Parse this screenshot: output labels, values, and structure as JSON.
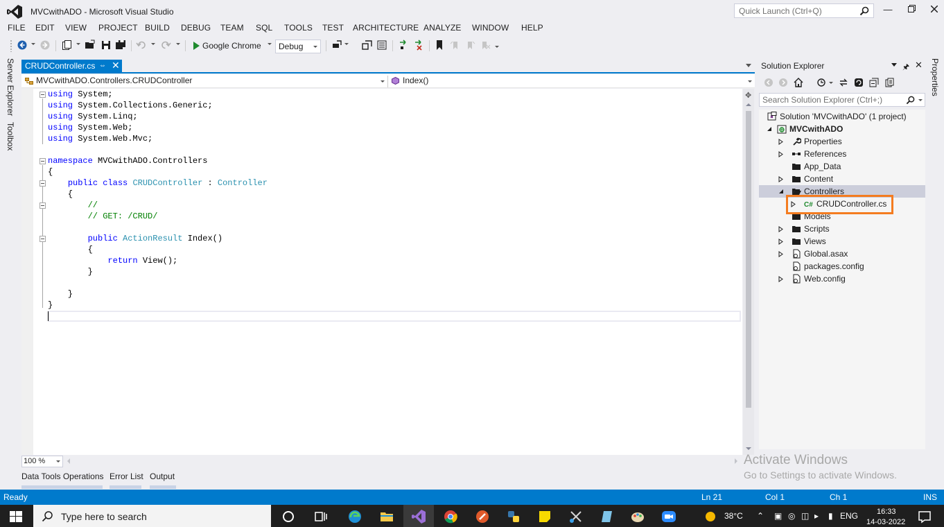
{
  "window": {
    "title": "MVCwithADO - Microsoft Visual Studio",
    "quick_launch_placeholder": "Quick Launch (Ctrl+Q)"
  },
  "menu": [
    "FILE",
    "EDIT",
    "VIEW",
    "PROJECT",
    "BUILD",
    "DEBUG",
    "TEAM",
    "SQL",
    "TOOLS",
    "TEST",
    "ARCHITECTURE",
    "ANALYZE",
    "WINDOW",
    "HELP"
  ],
  "toolbar": {
    "run_target": "Google Chrome",
    "configuration": "Debug"
  },
  "side_tabs": [
    "Server Explorer",
    "Toolbox"
  ],
  "document": {
    "tab_label": "CRUDController.cs",
    "nav_class": "MVCwithADO.Controllers.CRUDController",
    "nav_member": "Index()",
    "zoom": "100 %"
  },
  "code_lines": [
    [
      {
        "t": "using",
        "c": "kw"
      },
      {
        "t": " System;"
      }
    ],
    [
      {
        "t": "using",
        "c": "kw"
      },
      {
        "t": " System.Collections.Generic;"
      }
    ],
    [
      {
        "t": "using",
        "c": "kw"
      },
      {
        "t": " System.Linq;"
      }
    ],
    [
      {
        "t": "using",
        "c": "kw"
      },
      {
        "t": " System.Web;"
      }
    ],
    [
      {
        "t": "using",
        "c": "kw"
      },
      {
        "t": " System.Web.Mvc;"
      }
    ],
    [
      {
        "t": ""
      }
    ],
    [
      {
        "t": "namespace",
        "c": "kw"
      },
      {
        "t": " MVCwithADO.Controllers"
      }
    ],
    [
      {
        "t": "{"
      }
    ],
    [
      {
        "t": "    "
      },
      {
        "t": "public",
        "c": "kw"
      },
      {
        "t": " "
      },
      {
        "t": "class",
        "c": "kw"
      },
      {
        "t": " "
      },
      {
        "t": "CRUDController",
        "c": "ty"
      },
      {
        "t": " : "
      },
      {
        "t": "Controller",
        "c": "ty"
      }
    ],
    [
      {
        "t": "    {"
      }
    ],
    [
      {
        "t": "        "
      },
      {
        "t": "//",
        "c": "cm"
      }
    ],
    [
      {
        "t": "        "
      },
      {
        "t": "// GET: /CRUD/",
        "c": "cm"
      }
    ],
    [
      {
        "t": ""
      }
    ],
    [
      {
        "t": "        "
      },
      {
        "t": "public",
        "c": "kw"
      },
      {
        "t": " "
      },
      {
        "t": "ActionResult",
        "c": "ty"
      },
      {
        "t": " Index()"
      }
    ],
    [
      {
        "t": "        {"
      }
    ],
    [
      {
        "t": "            "
      },
      {
        "t": "return",
        "c": "kw"
      },
      {
        "t": " View();"
      }
    ],
    [
      {
        "t": "        }"
      }
    ],
    [
      {
        "t": ""
      }
    ],
    [
      {
        "t": "    }"
      }
    ],
    [
      {
        "t": "}"
      }
    ],
    [
      {
        "t": ""
      }
    ]
  ],
  "bottom_tabs": [
    "Data Tools Operations",
    "Error List",
    "Output"
  ],
  "solution_explorer": {
    "title": "Solution Explorer",
    "search_placeholder": "Search Solution Explorer (Ctrl+;)",
    "items": [
      {
        "label": "Solution 'MVCwithADO' (1 project)",
        "icon": "solution-icon"
      },
      {
        "label": "MVCwithADO",
        "icon": "web-project-icon"
      },
      {
        "label": "Properties",
        "icon": "wrench-icon"
      },
      {
        "label": "References",
        "icon": "references-icon"
      },
      {
        "label": "App_Data",
        "icon": "folder-icon"
      },
      {
        "label": "Content",
        "icon": "folder-icon"
      },
      {
        "label": "Controllers",
        "icon": "folder-open-icon"
      },
      {
        "label": "CRUDController.cs",
        "icon": "csharp-file-icon"
      },
      {
        "label": "Models",
        "icon": "folder-icon"
      },
      {
        "label": "Scripts",
        "icon": "folder-icon"
      },
      {
        "label": "Views",
        "icon": "folder-icon"
      },
      {
        "label": "Global.asax",
        "icon": "config-file-icon"
      },
      {
        "label": "packages.config",
        "icon": "config-file-icon"
      },
      {
        "label": "Web.config",
        "icon": "config-file-icon"
      }
    ]
  },
  "properties_tab": "Properties",
  "watermark": {
    "line1": "Activate Windows",
    "line2": "Go to Settings to activate Windows."
  },
  "status": {
    "state": "Ready",
    "ln": "Ln 21",
    "col": "Col 1",
    "ch": "Ch 1",
    "mode": "INS"
  },
  "taskbar": {
    "search_placeholder": "Type here to search",
    "temperature": "38°C",
    "language": "ENG",
    "time": "16:33",
    "date": "14-03-2022"
  },
  "colors": {
    "accent": "#007acc",
    "highlight": "#f47c20",
    "keyword": "#0000ff",
    "type": "#2b91af",
    "comment": "#008000"
  }
}
